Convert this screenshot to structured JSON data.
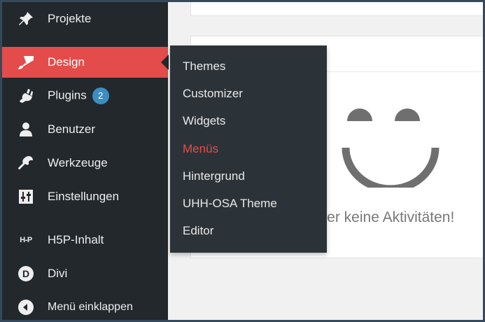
{
  "sidebar": {
    "items": [
      {
        "label": "Projekte",
        "icon": "pin-icon"
      },
      {
        "label": "Design",
        "icon": "paintbrush-icon",
        "active": true
      },
      {
        "label": "Plugins",
        "icon": "plug-icon",
        "badge": "2"
      },
      {
        "label": "Benutzer",
        "icon": "user-icon"
      },
      {
        "label": "Werkzeuge",
        "icon": "wrench-icon"
      },
      {
        "label": "Einstellungen",
        "icon": "sliders-icon"
      },
      {
        "label": "H5P-Inhalt",
        "icon": "h5p-icon",
        "icon_text": "H-P"
      },
      {
        "label": "Divi",
        "icon": "divi-icon",
        "icon_text": "D"
      },
      {
        "label": "Menü einklappen",
        "icon": "collapse-icon"
      }
    ]
  },
  "submenu": {
    "items": [
      {
        "label": "Themes"
      },
      {
        "label": "Customizer"
      },
      {
        "label": "Widgets"
      },
      {
        "label": "Menüs",
        "current": true
      },
      {
        "label": "Hintergrund"
      },
      {
        "label": "UHH-OSA Theme"
      },
      {
        "label": "Editor"
      }
    ]
  },
  "activity": {
    "empty_message": "sher keine Aktivitäten!"
  },
  "colors": {
    "sidebar_bg": "#23282d",
    "active_bg": "#e34c4a",
    "flyout_bg": "#2c3338",
    "badge_bg": "#3b8ec2",
    "current_submenu_text": "#e34c4a",
    "smiley": "#6f6f6f"
  }
}
